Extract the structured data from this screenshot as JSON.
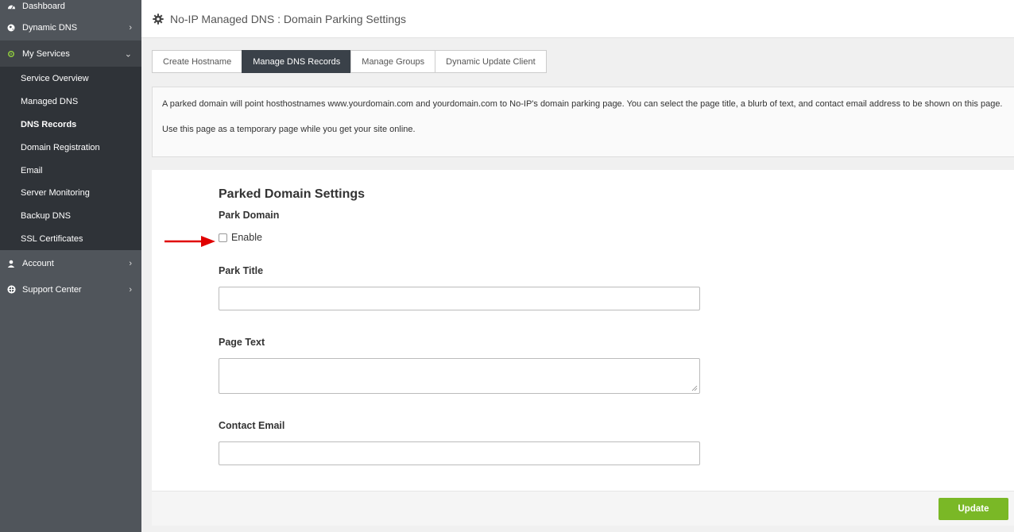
{
  "sidebar": {
    "items": [
      {
        "label": "Dashboard",
        "icon": "dashboard-icon"
      },
      {
        "label": "Dynamic DNS",
        "icon": "globe-icon"
      },
      {
        "label": "My Services",
        "icon": "gear-icon"
      },
      {
        "label": "Account",
        "icon": "user-icon"
      },
      {
        "label": "Support Center",
        "icon": "lifebuoy-icon"
      }
    ],
    "sub_items": [
      "Service Overview",
      "Managed DNS",
      "DNS Records",
      "Domain Registration",
      "Email",
      "Server Monitoring",
      "Backup DNS",
      "SSL Certificates"
    ]
  },
  "header": {
    "title": "No-IP Managed DNS : Domain Parking Settings"
  },
  "tabs": [
    {
      "label": "Create Hostname",
      "active": false
    },
    {
      "label": "Manage DNS Records",
      "active": true
    },
    {
      "label": "Manage Groups",
      "active": false
    },
    {
      "label": "Dynamic Update Client",
      "active": false
    }
  ],
  "info": {
    "line1": "A parked domain will point hosthostnames www.yourdomain.com and yourdomain.com to No-IP's domain parking page. You can select the page title, a blurb of text, and contact email address to be shown on this page.",
    "line2": "Use this page as a temporary page while you get your site online."
  },
  "form": {
    "heading": "Parked Domain Settings",
    "park_domain_label": "Park Domain",
    "enable_label": "Enable",
    "enable_checked": false,
    "park_title_label": "Park Title",
    "park_title_value": "",
    "page_text_label": "Page Text",
    "page_text_value": "",
    "contact_email_label": "Contact Email",
    "contact_email_value": "",
    "update_label": "Update"
  },
  "colors": {
    "sidebar_bg": "#50555b",
    "sidebar_sub_bg": "#2f3338",
    "active_tab_bg": "#3a4149",
    "update_button": "#7ab826",
    "annotation_arrow": "#e00000",
    "my_services_icon": "#8cc63f"
  }
}
